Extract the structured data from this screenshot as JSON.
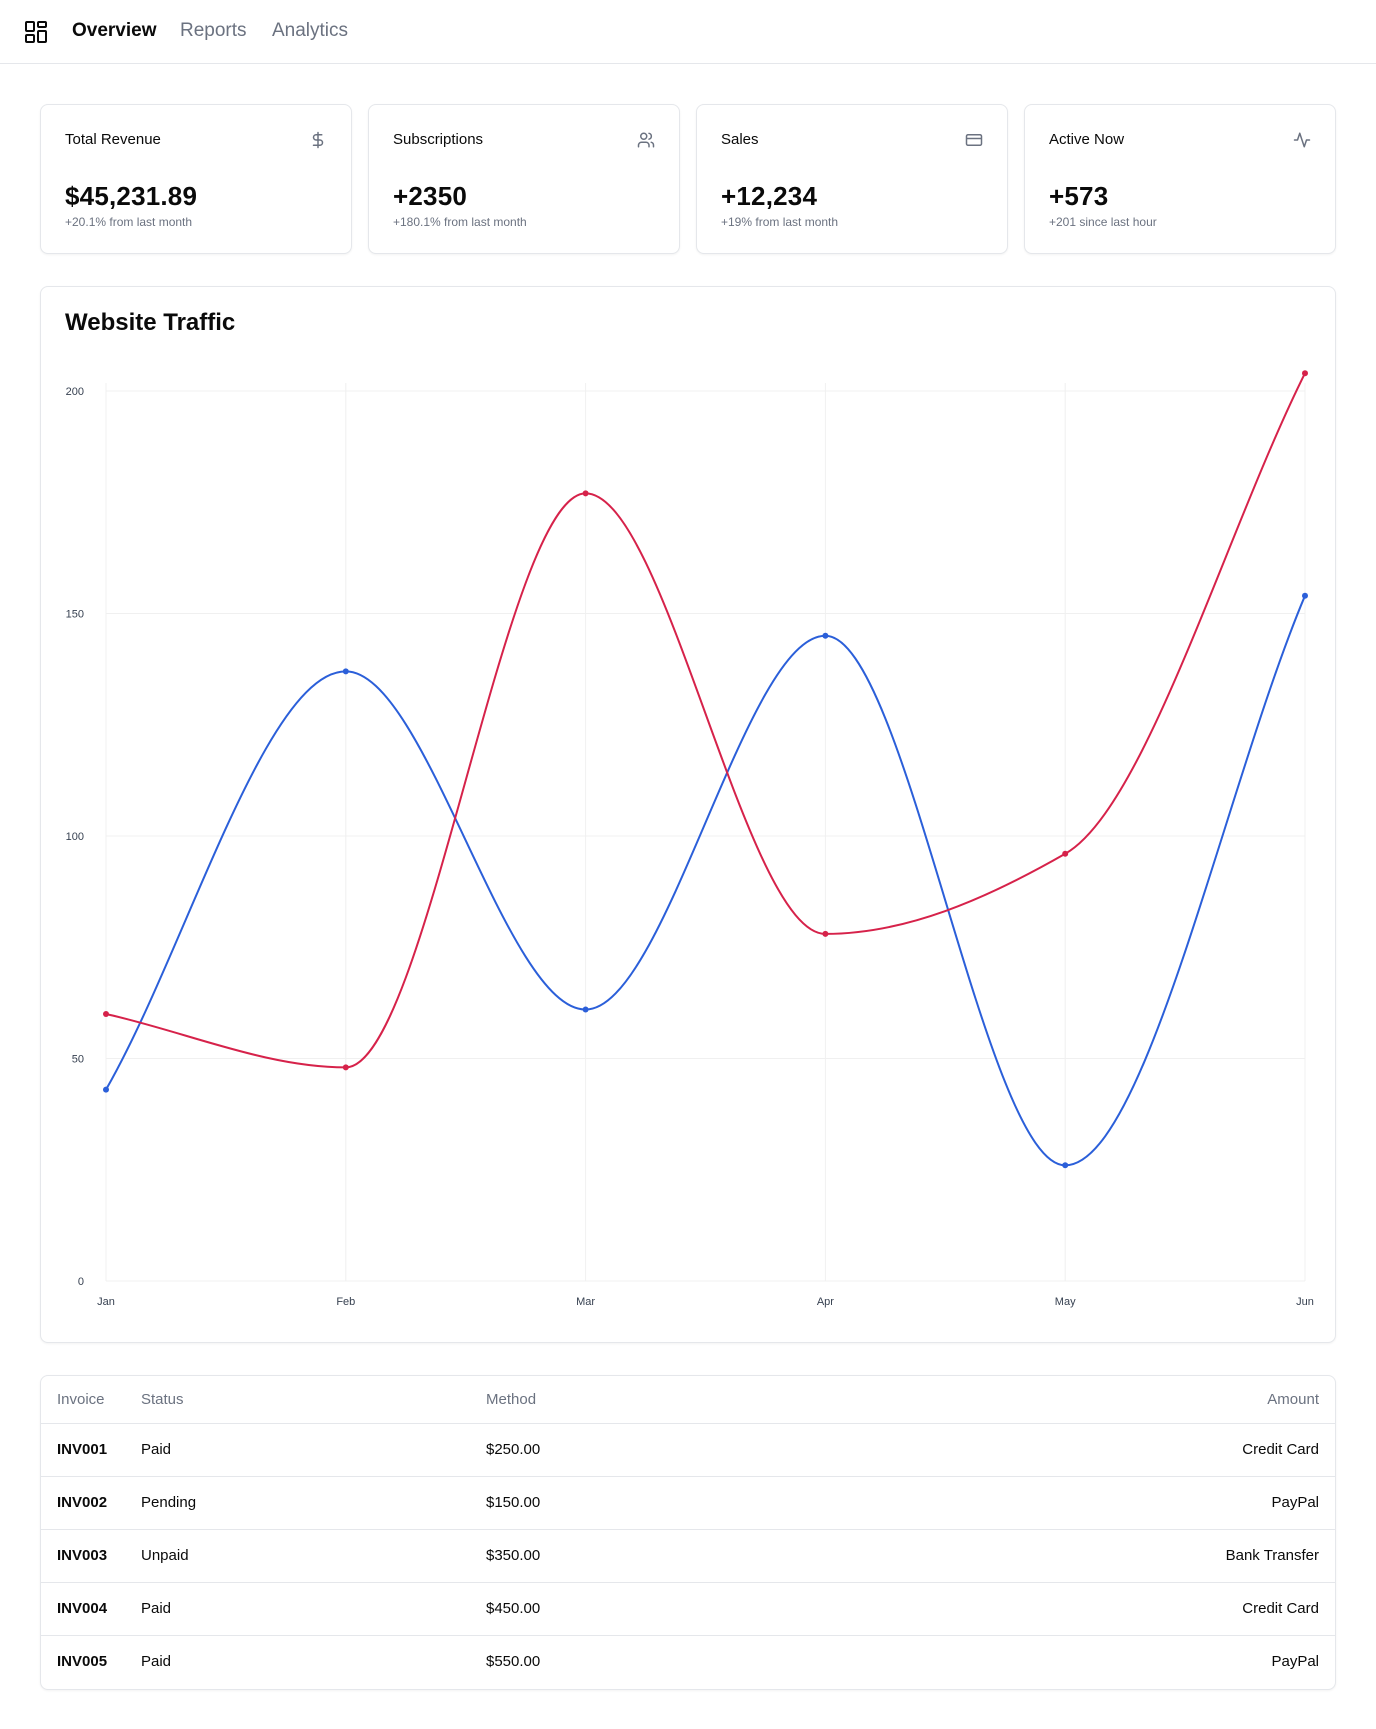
{
  "nav": {
    "logo_icon": "dashboard-grid-icon",
    "links": [
      {
        "label": "Overview",
        "active": true
      },
      {
        "label": "Reports",
        "active": false
      },
      {
        "label": "Analytics",
        "active": false
      }
    ]
  },
  "stats": [
    {
      "title": "Total Revenue",
      "value": "$45,231.89",
      "sub": "+20.1% from last month",
      "icon": "dollar-icon"
    },
    {
      "title": "Subscriptions",
      "value": "+2350",
      "sub": "+180.1% from last month",
      "icon": "users-icon"
    },
    {
      "title": "Sales",
      "value": "+12,234",
      "sub": "+19% from last month",
      "icon": "credit-card-icon"
    },
    {
      "title": "Active Now",
      "value": "+573",
      "sub": "+201 since last hour",
      "icon": "activity-icon"
    }
  ],
  "chart": {
    "title": "Website Traffic"
  },
  "chart_data": {
    "type": "line",
    "title": "Website Traffic",
    "x": [
      "Jan",
      "Feb",
      "Mar",
      "Apr",
      "May",
      "Jun"
    ],
    "y_ticks": [
      0,
      50,
      100,
      150,
      200
    ],
    "ylim": [
      0,
      200
    ],
    "grid": true,
    "legend": "none",
    "series": [
      {
        "color": "#2b5fd9",
        "values": [
          43,
          137,
          61,
          145,
          26,
          154
        ]
      },
      {
        "color": "#d6224a",
        "values": [
          60,
          48,
          177,
          78,
          96,
          204
        ]
      }
    ]
  },
  "table": {
    "headers": [
      "Invoice",
      "Status",
      "Method",
      "Amount"
    ],
    "rows": [
      [
        "INV001",
        "Paid",
        "$250.00",
        "Credit Card"
      ],
      [
        "INV002",
        "Pending",
        "$150.00",
        "PayPal"
      ],
      [
        "INV003",
        "Unpaid",
        "$350.00",
        "Bank Transfer"
      ],
      [
        "INV004",
        "Paid",
        "$450.00",
        "Credit Card"
      ],
      [
        "INV005",
        "Paid",
        "$550.00",
        "PayPal"
      ]
    ]
  }
}
